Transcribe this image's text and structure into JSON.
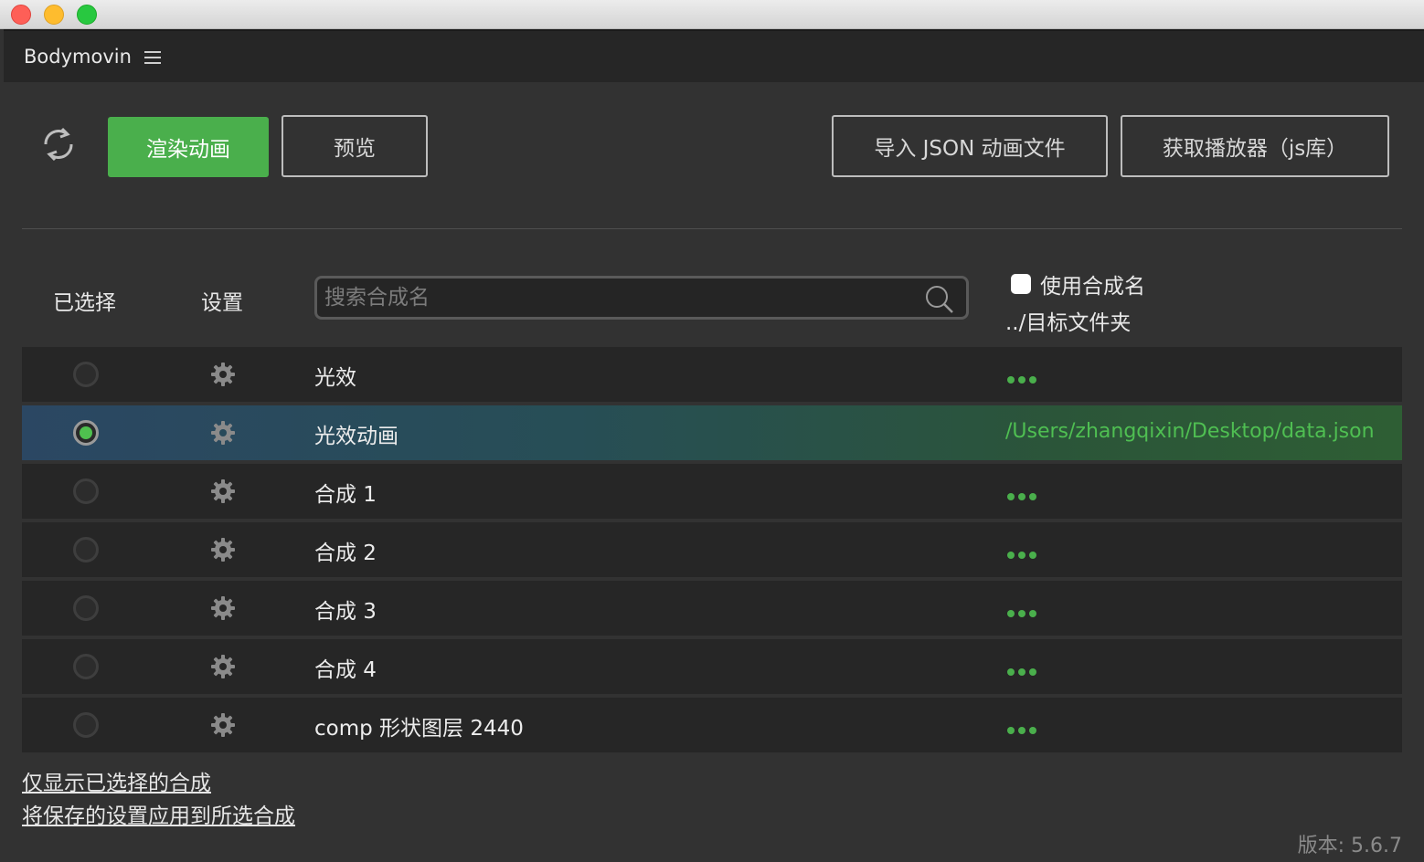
{
  "window": {
    "close_color": "#fe5f57",
    "minimize_color": "#febc2e",
    "maximize_color": "#28c840"
  },
  "panel": {
    "title": "Bodymovin",
    "menu_icon": "hamburger-icon"
  },
  "toolbar": {
    "refresh_icon": "refresh-icon",
    "render_label": "渲染动画",
    "preview_label": "预览",
    "import_label": "导入 JSON 动画文件",
    "player_label": "获取播放器（js库）",
    "accent_color": "#4aaf4c"
  },
  "list_header": {
    "selected_label": "已选择",
    "settings_label": "设置",
    "search_placeholder": "搜索合成名",
    "use_comp_name_label": "使用合成名",
    "use_comp_name_checked": false,
    "target_folder_label": "../目标文件夹"
  },
  "compositions": [
    {
      "name": "光效",
      "selected": false,
      "destination": ""
    },
    {
      "name": "光效动画",
      "selected": true,
      "destination": "/Users/zhangqixin/Desktop/data.json"
    },
    {
      "name": "合成 1",
      "selected": false,
      "destination": ""
    },
    {
      "name": "合成 2",
      "selected": false,
      "destination": ""
    },
    {
      "name": "合成 3",
      "selected": false,
      "destination": ""
    },
    {
      "name": "合成 4",
      "selected": false,
      "destination": ""
    },
    {
      "name": "comp 形状图层 2440",
      "selected": false,
      "destination": ""
    }
  ],
  "footer": {
    "show_selected_link": "仅显示已选择的合成",
    "apply_settings_link": "将保存的设置应用到所选合成",
    "version": "版本: 5.6.7"
  }
}
